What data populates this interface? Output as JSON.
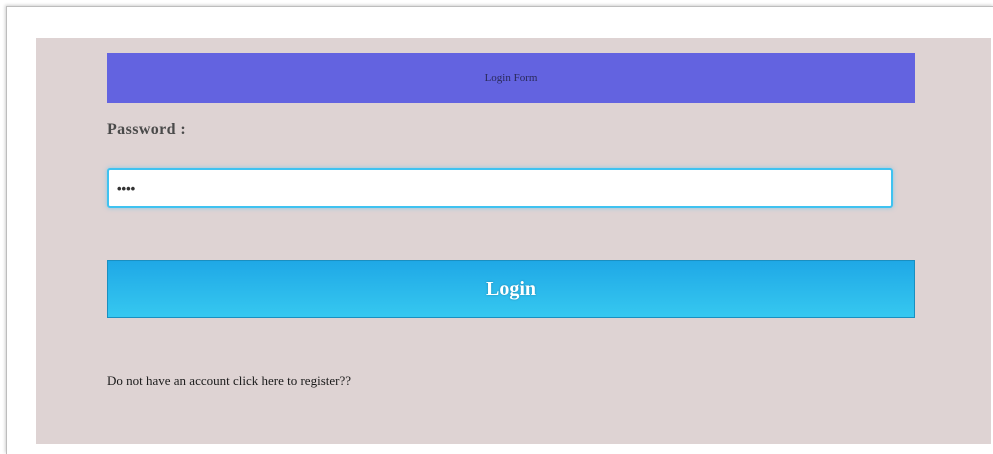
{
  "form": {
    "title": "Login Form",
    "password_label": "Password :",
    "password_value": "abcd",
    "login_button_label": "Login",
    "register_text": "Do not have an account click here to register??"
  },
  "colors": {
    "panel_background": "#ded3d3",
    "header_background": "#6363e0",
    "button_gradient_top": "#1fa8e6",
    "button_gradient_bottom": "#36c8f0",
    "input_focus_border": "#3fc2f0"
  }
}
